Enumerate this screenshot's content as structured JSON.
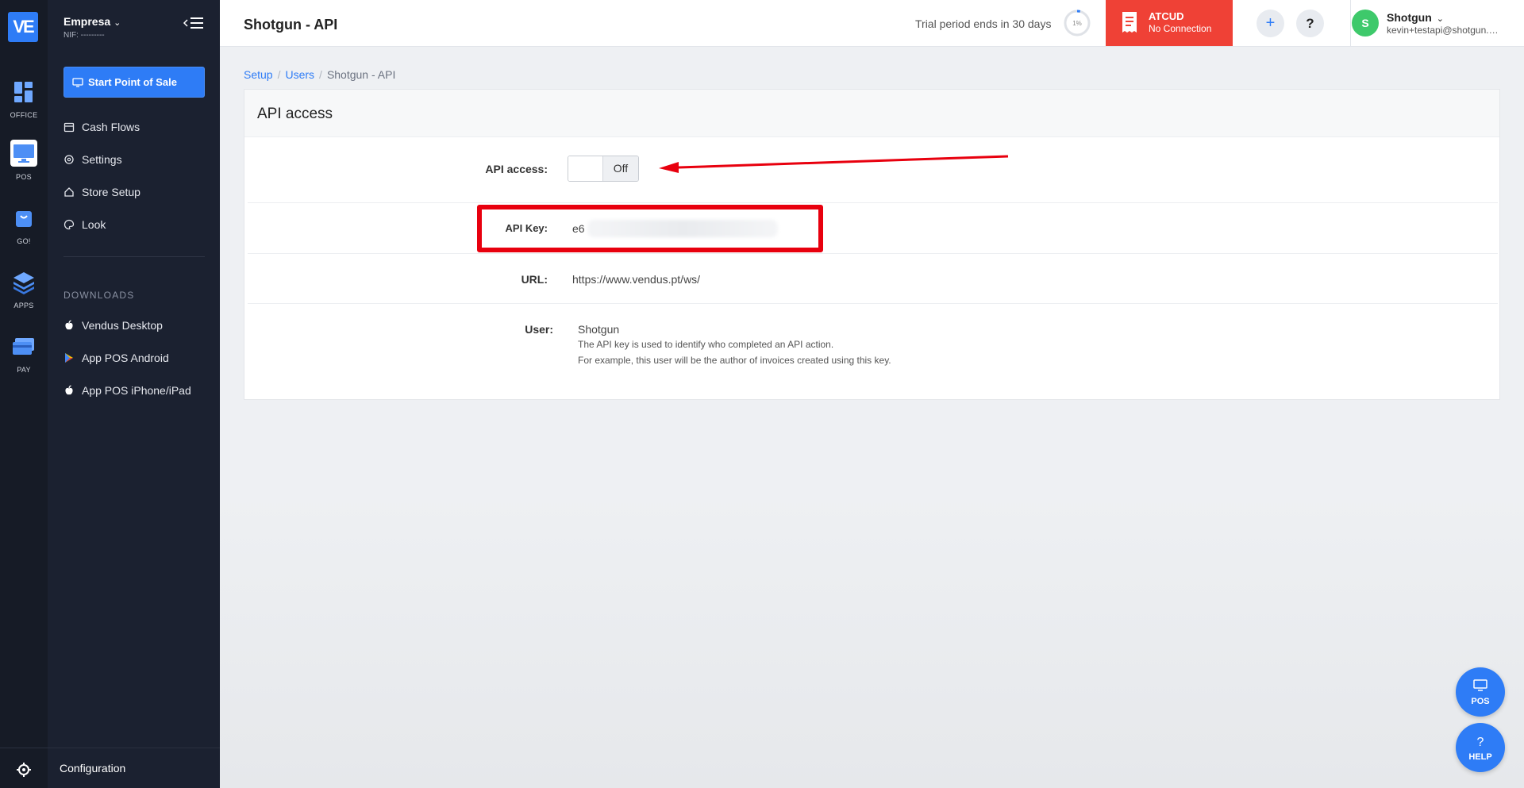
{
  "rail": {
    "logo": "VE",
    "items": [
      {
        "label": "OFFICE"
      },
      {
        "label": "POS"
      },
      {
        "label": "GO!"
      },
      {
        "label": "APPS"
      },
      {
        "label": "PAY"
      }
    ]
  },
  "sidebar": {
    "company": "Empresa",
    "nif": "NIF: ---------",
    "pos_button": "Start Point of Sale",
    "nav": [
      "Cash Flows",
      "Settings",
      "Store Setup",
      "Look"
    ],
    "downloads_title": "DOWNLOADS",
    "downloads": [
      "Vendus Desktop",
      "App POS Android",
      "App POS iPhone/iPad"
    ],
    "configuration": "Configuration"
  },
  "topbar": {
    "title": "Shotgun - API",
    "trial": "Trial period ends in 30 days",
    "progress_label": "1%",
    "progress": 0.01,
    "atcud_title": "ATCUD",
    "atcud_status": "No Connection",
    "add": "+",
    "help": "?",
    "user_initial": "S",
    "user_name": "Shotgun",
    "user_email": "kevin+testapi@shotgun.com"
  },
  "breadcrumb": [
    "Setup",
    "Users",
    "Shotgun - API"
  ],
  "panel": {
    "title": "API access",
    "api_access_label": "API access:",
    "api_access_state": "Off",
    "api_key_label": "API Key:",
    "api_key_value": "e6",
    "url_label": "URL:",
    "url_value": "https://www.vendus.pt/ws/",
    "user_label": "User:",
    "user_value": "Shotgun",
    "user_note_1": "The API key is used to identify who completed an API action.",
    "user_note_2": "For example, this user will be the author of invoices created using this key."
  },
  "fab": {
    "pos": "POS",
    "help": "HELP"
  },
  "colors": {
    "accent": "#2e7cf6",
    "atcud": "#ef4136",
    "annotation": "#e8000e",
    "avatar": "#3ec96b"
  }
}
